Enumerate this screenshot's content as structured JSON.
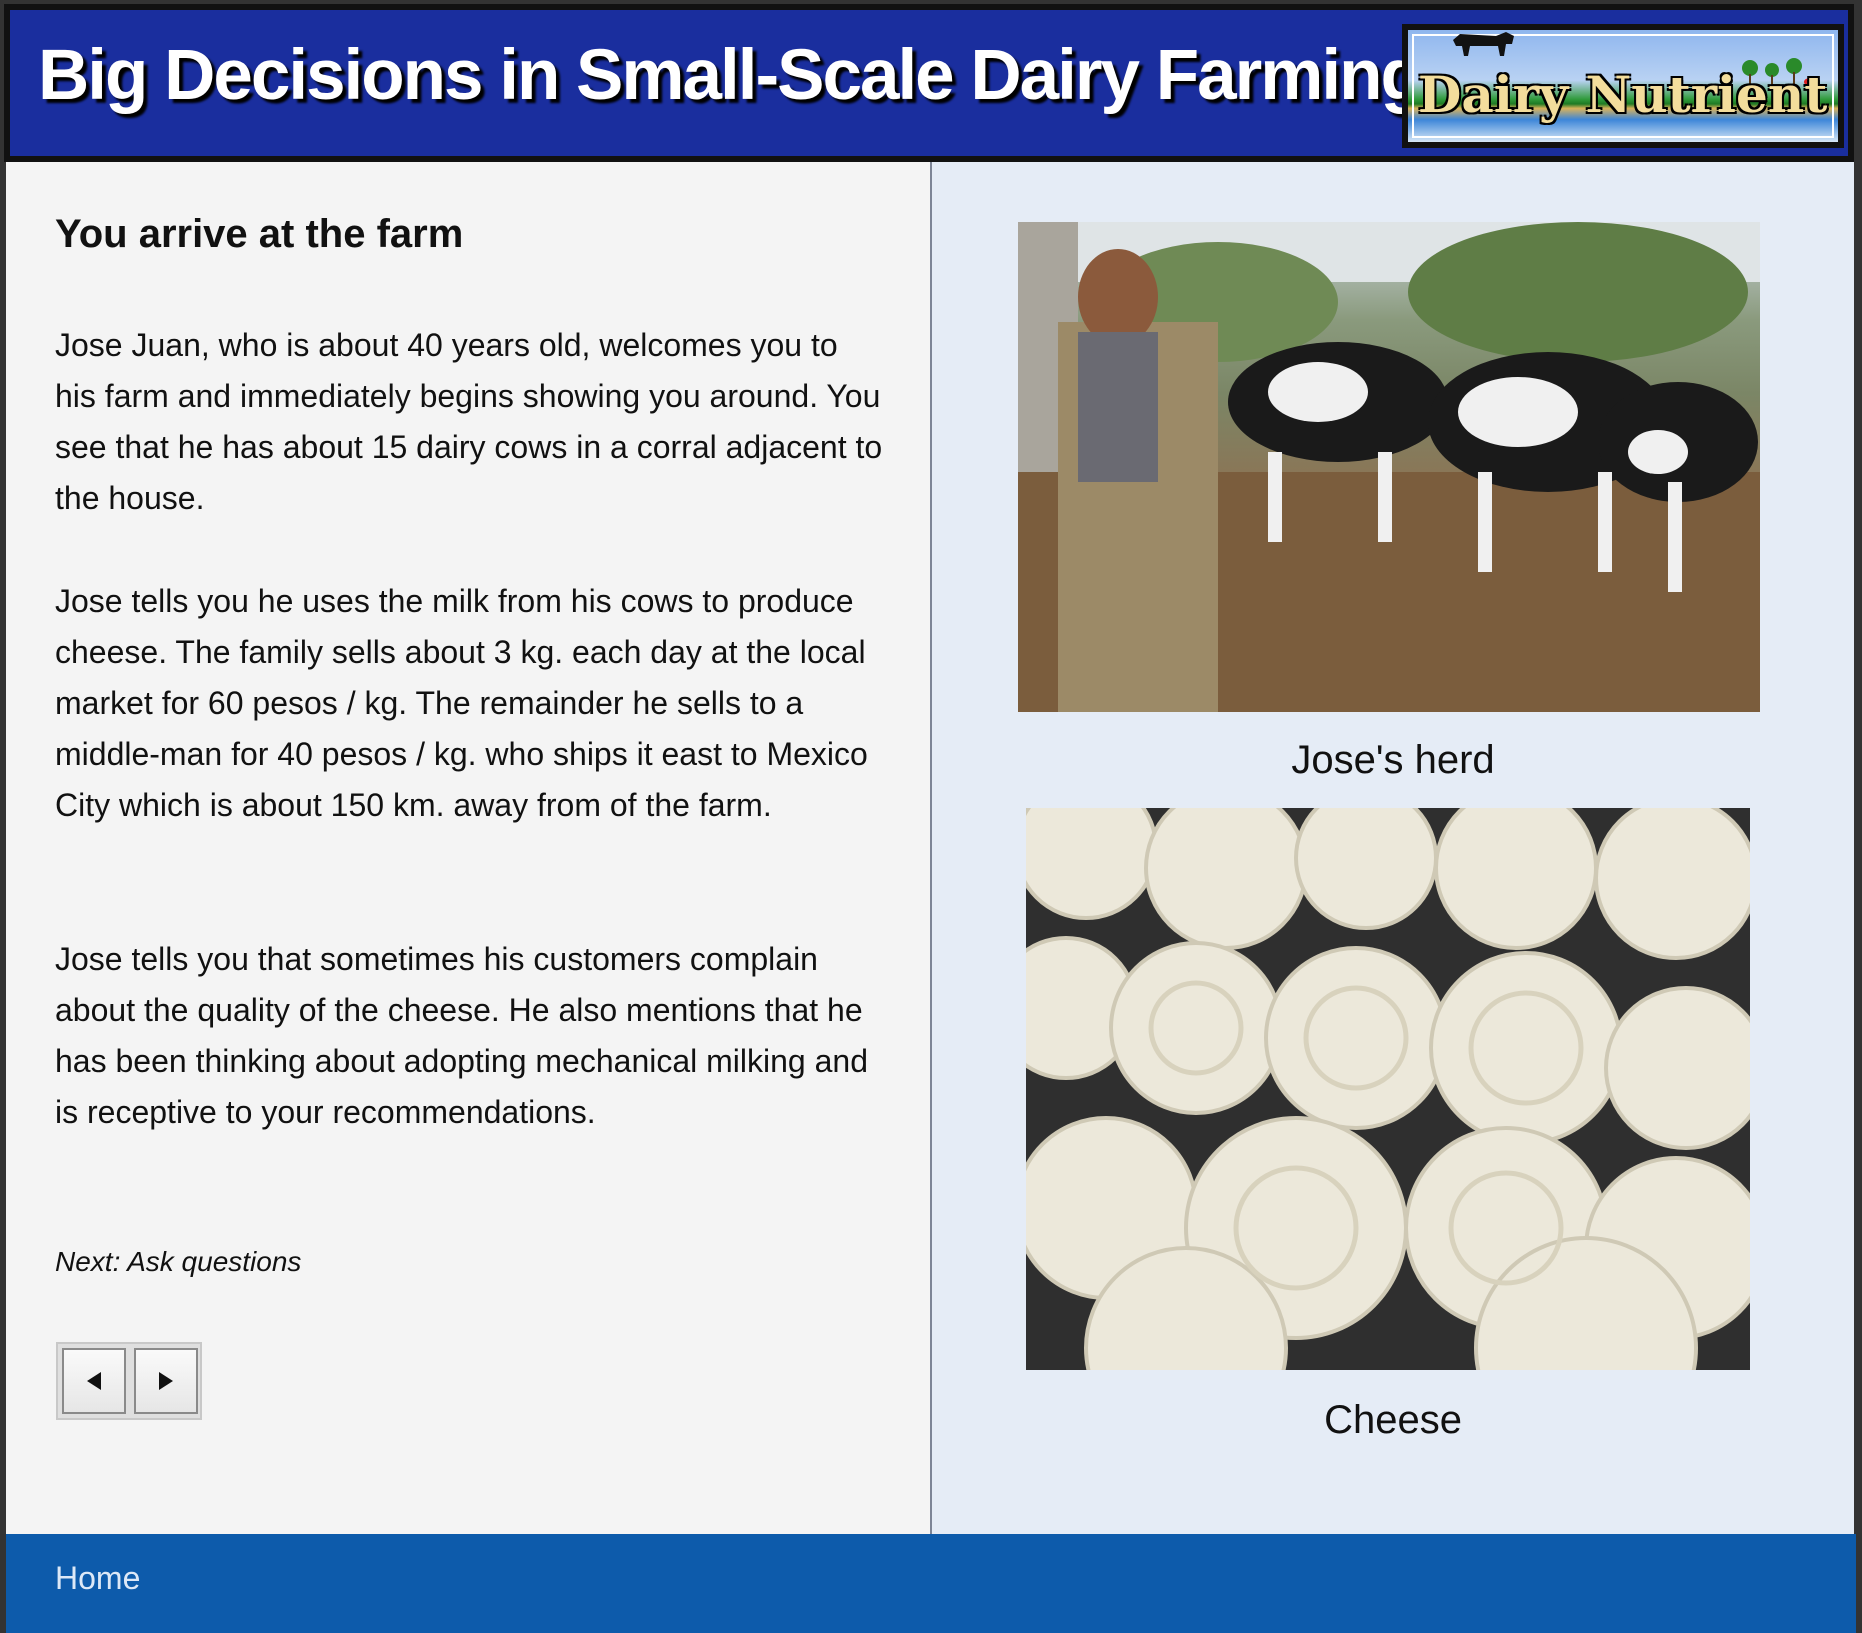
{
  "header": {
    "title": "Big Decisions in Small-Scale Dairy Farming",
    "logo_text": "Dairy Nutrient"
  },
  "content": {
    "heading": "You arrive at the farm",
    "paragraphs": [
      "Jose Juan, who is about 40 years old, welcomes you to his farm and immediately begins showing you around. You see that he has about 15 dairy cows in a corral adjacent to the house.",
      "Jose tells you he uses the milk from his cows to produce cheese. The family sells about 3 kg. each day at the local market for 60 pesos / kg. The remainder he sells to a middle-man for 40 pesos / kg. who ships it east to Mexico City which is about 150 km. away from of the farm.",
      "Jose tells you that sometimes his customers complain about the quality of the cheese. He also mentions that he has been thinking about adopting mechanical milking and is receptive to your recommendations."
    ],
    "next_label": "Next: Ask questions",
    "nav": {
      "prev_icon": "triangle-left-icon",
      "next_icon": "triangle-right-icon"
    }
  },
  "images": [
    {
      "caption": "Jose's herd"
    },
    {
      "caption": "Cheese"
    }
  ],
  "footer": {
    "home_label": "Home"
  },
  "colors": {
    "header_bg": "#1a2e9e",
    "footer_bg": "#0d5bab",
    "left_bg": "#f4f4f4",
    "right_bg": "#e5ecf6"
  }
}
